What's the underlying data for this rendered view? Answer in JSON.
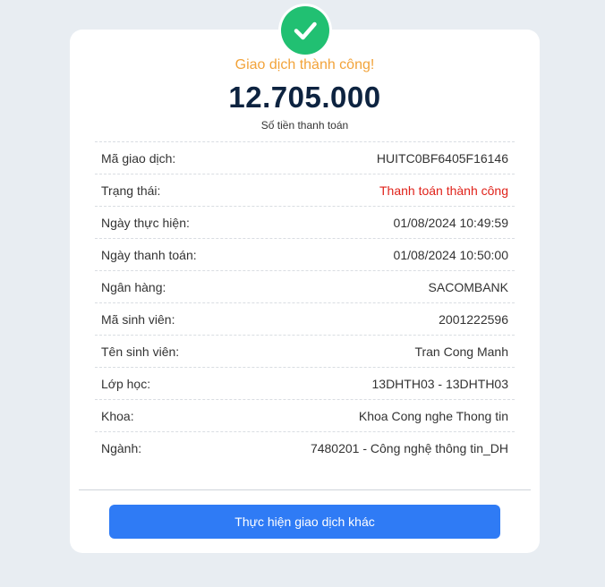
{
  "header": {
    "status_title": "Giao dịch thành công!",
    "amount": "12.705.000",
    "amount_caption": "Số tiền thanh toán",
    "icon": "check-circle-icon",
    "success_color": "#21c072"
  },
  "details": [
    {
      "label": "Mã giao dịch:",
      "value": "HUITC0BF6405F16146"
    },
    {
      "label": "Trạng thái:",
      "value": "Thanh toán thành công"
    },
    {
      "label": "Ngày thực hiện:",
      "value": "01/08/2024 10:49:59"
    },
    {
      "label": "Ngày thanh toán:",
      "value": "01/08/2024 10:50:00"
    },
    {
      "label": "Ngân hàng:",
      "value": "SACOMBANK"
    },
    {
      "label": "Mã sinh viên:",
      "value": "2001222596"
    },
    {
      "label": "Tên sinh viên:",
      "value": "Tran Cong Manh"
    },
    {
      "label": "Lớp học:",
      "value": "13DHTH03 - 13DHTH03"
    },
    {
      "label": "Khoa:",
      "value": "Khoa Cong nghe Thong tin"
    },
    {
      "label": "Ngành:",
      "value": "7480201 - Công nghệ thông tin_DH"
    }
  ],
  "actions": {
    "new_transaction_label": "Thực hiện giao dịch khác",
    "button_color": "#2f7bf5"
  },
  "colors": {
    "status_title": "#f2a33a",
    "amount": "#0d2340",
    "status_value": "#e0231b"
  }
}
